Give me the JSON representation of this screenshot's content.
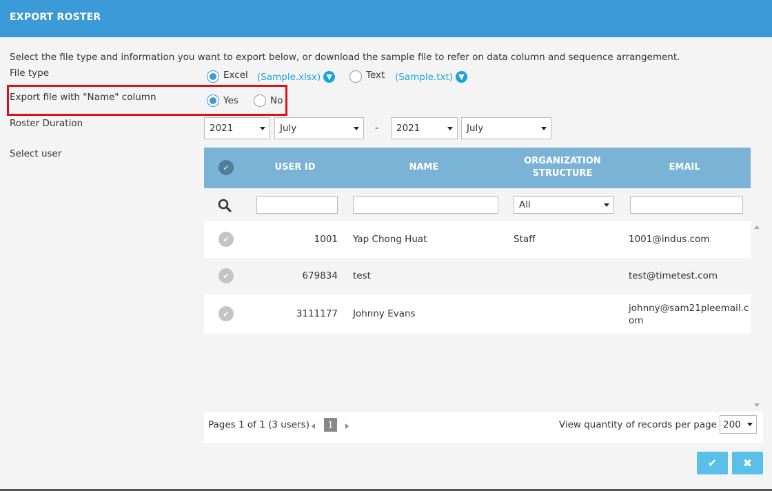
{
  "dialog": {
    "title": "EXPORT ROSTER"
  },
  "intro": "Select the file type and information you want to export below, or download the sample file to refer on data column and sequence arrangement.",
  "file_type": {
    "label": "File type",
    "excel_label": "Excel",
    "excel_sample": "(Sample.xlsx)",
    "text_label": "Text",
    "text_sample": "(Sample.txt)",
    "selected": "Excel"
  },
  "name_column": {
    "label": "Export file with \"Name\" column",
    "yes_label": "Yes",
    "no_label": "No",
    "selected": "Yes"
  },
  "duration": {
    "label": "Roster Duration",
    "from_year": "2021",
    "from_month": "July",
    "separator": "-",
    "to_year": "2021",
    "to_month": "July"
  },
  "select_user": {
    "label": "Select user"
  },
  "table": {
    "headers": {
      "user_id": "USER ID",
      "name": "NAME",
      "org_line1": "ORGANIZATION",
      "org_line2": "STRUCTURE",
      "email": "EMAIL"
    },
    "org_filter": "All",
    "rows": [
      {
        "user_id": "1001",
        "name": "Yap Chong Huat",
        "org": "Staff",
        "email": "1001@indus.com"
      },
      {
        "user_id": "679834",
        "name": "test",
        "org": "",
        "email": "test@timetest.com"
      },
      {
        "user_id": "3111177",
        "name": "Johnny Evans",
        "org": "",
        "email_line1": "johnny@sam21pleemail.c",
        "email_line2": "om"
      }
    ]
  },
  "pager": {
    "summary": "Pages 1 of 1 (3 users)",
    "current_page": "1",
    "per_page_label": "View quantity of records per page",
    "per_page_value": "200"
  },
  "colors": {
    "header": "#3b9ad8",
    "accent": "#1aa4dc",
    "highlight": "#d9131c",
    "button": "#5bc0e8"
  },
  "icons": {
    "confirm": "check-icon",
    "cancel": "close-icon",
    "search": "search-icon",
    "download": "download-icon"
  }
}
